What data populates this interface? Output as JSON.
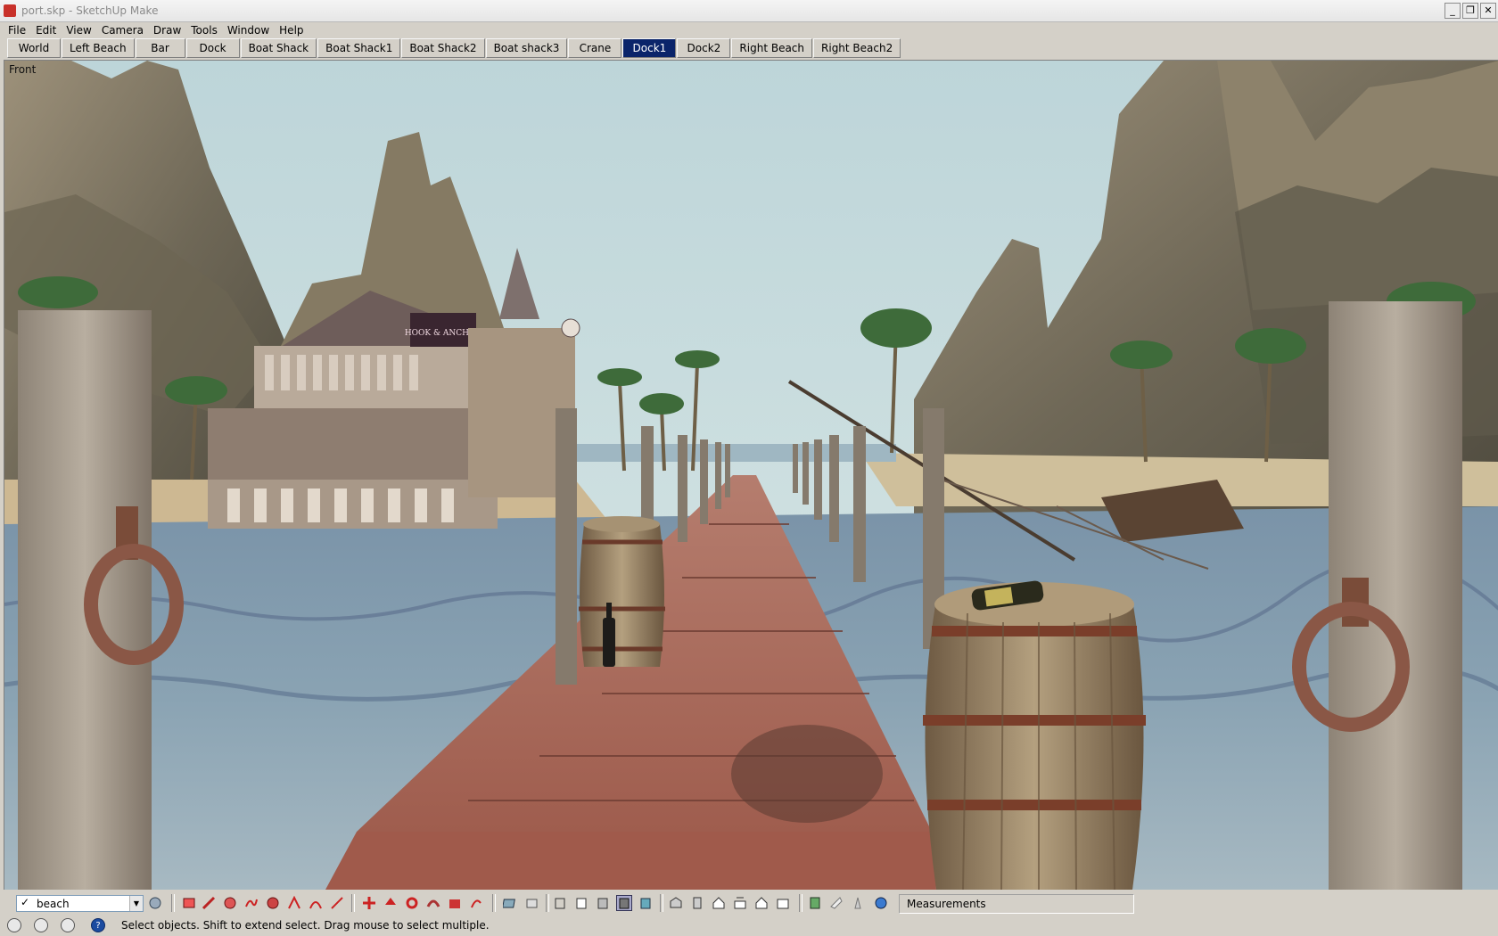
{
  "window": {
    "title": "port.skp - SketchUp Make",
    "controls": [
      "_",
      "❐",
      "✕"
    ]
  },
  "menu": [
    "File",
    "Edit",
    "View",
    "Camera",
    "Draw",
    "Tools",
    "Window",
    "Help"
  ],
  "scenes": {
    "tabs": [
      "World",
      "Left Beach",
      "Bar",
      "Dock",
      "Boat Shack",
      "Boat Shack1",
      "Boat Shack2",
      "Boat shack3",
      "Crane",
      "Dock1",
      "Dock2",
      "Right Beach",
      "Right Beach2"
    ],
    "active": "Dock1"
  },
  "viewport": {
    "view_label": "Front",
    "sign_text": "HOOK & ANCHOR"
  },
  "toolbar": {
    "layer": {
      "checked": "✓",
      "value": "beach"
    },
    "measurements_label": "Measurements",
    "icons": [
      "layer-manager-icon",
      "eraser-icon",
      "pencil-icon",
      "circle-icon",
      "freehand-icon",
      "offset-icon",
      "arc-icon",
      "push-pull-icon",
      "paint-icon",
      "move-icon",
      "rotate-icon",
      "follow-me-icon",
      "scale-icon",
      "tape-icon",
      "style-xray-icon",
      "style-back-edges-icon",
      "style-wireframe-icon",
      "style-hidden-line-icon",
      "style-shaded-icon",
      "style-textured-icon",
      "style-monochrome-icon",
      "view-iso-icon",
      "view-top-icon",
      "view-front-icon",
      "view-right-icon",
      "view-back-icon",
      "view-left-icon",
      "components-icon",
      "materials-icon",
      "section-icon",
      "geolocation-icon"
    ]
  },
  "status": {
    "text": "Select objects. Shift to extend select. Drag mouse to select multiple.",
    "icons": [
      "geo-icon",
      "credits-icon",
      "user-icon",
      "help-icon"
    ],
    "help_glyph": "?"
  },
  "colors": {
    "sky": "#c5dcdf",
    "water": "#6e8aa3",
    "dock_wood": "#a5675a",
    "active_tab": "#0a246a",
    "chrome": "#d4d0c8"
  }
}
